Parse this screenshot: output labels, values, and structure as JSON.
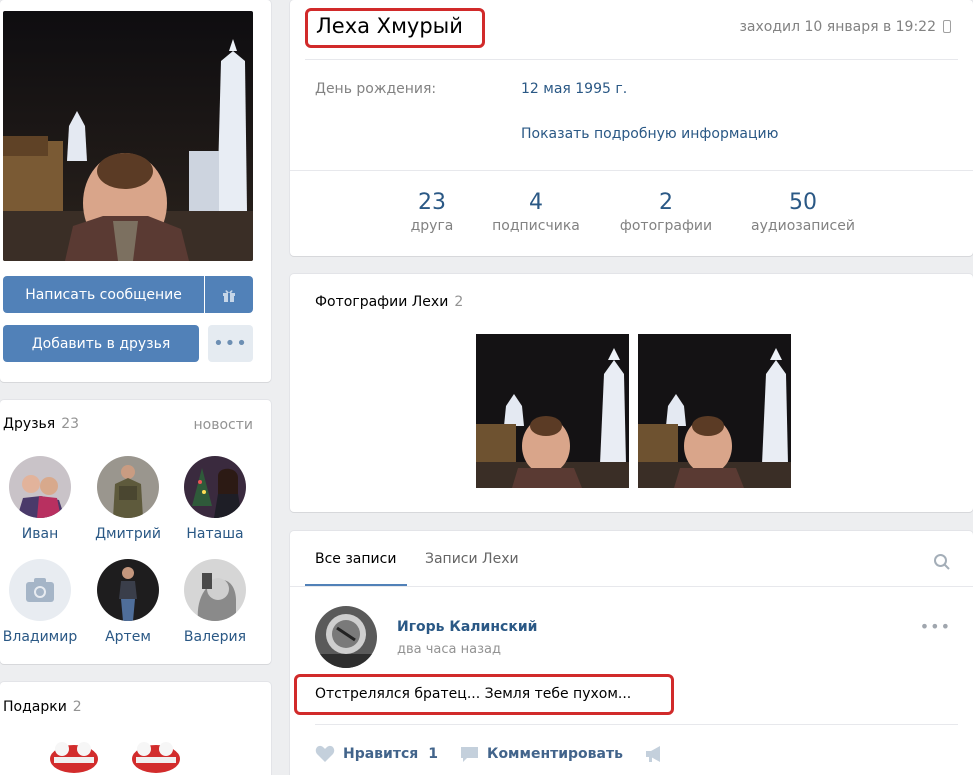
{
  "profile": {
    "name": "Леха Хмурый",
    "last_seen": "заходил 10 января в 19:22",
    "birthday_label": "День рождения:",
    "birthday_value": "12 мая 1995 г.",
    "show_more": "Показать подробную информацию",
    "stats": [
      {
        "num": "23",
        "label": "друга"
      },
      {
        "num": "4",
        "label": "подписчика"
      },
      {
        "num": "2",
        "label": "фотографии"
      },
      {
        "num": "50",
        "label": "аудиозаписей"
      }
    ]
  },
  "actions": {
    "message": "Написать сообщение",
    "add_friend": "Добавить в друзья",
    "more": "•••"
  },
  "friends": {
    "title": "Друзья",
    "count": "23",
    "news": "новости",
    "items": [
      {
        "name": "Иван"
      },
      {
        "name": "Дмитрий"
      },
      {
        "name": "Наташа"
      },
      {
        "name": "Владимир"
      },
      {
        "name": "Артем"
      },
      {
        "name": "Валерия"
      }
    ]
  },
  "gifts": {
    "title": "Подарки",
    "count": "2"
  },
  "photos": {
    "title": "Фотографии Лехи",
    "count": "2"
  },
  "wall": {
    "tabs": [
      "Все записи",
      "Записи Лехи"
    ],
    "post": {
      "author": "Игорь Калинский",
      "time": "два часа назад",
      "text": "Отстрелялся братец... Земля тебе пухом...",
      "like_label": "Нравится",
      "like_count": "1",
      "comment_label": "Комментировать",
      "menu": "•••"
    }
  },
  "colors": {
    "accent": "#5181b8",
    "link": "#2a5885",
    "highlight_border": "#d12a2a"
  }
}
